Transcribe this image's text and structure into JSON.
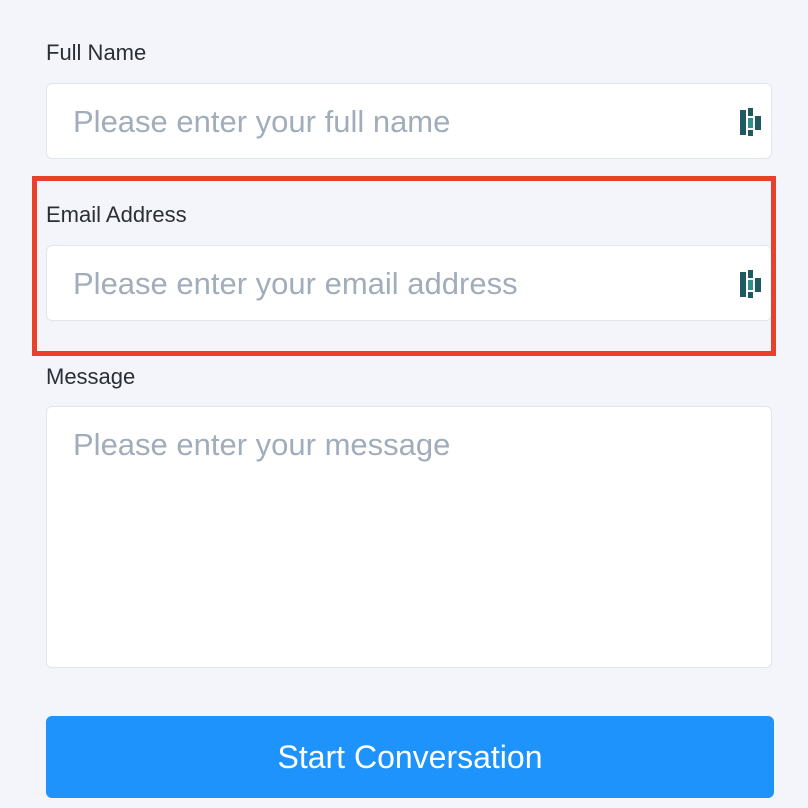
{
  "form": {
    "full_name": {
      "label": "Full Name",
      "value": "",
      "placeholder": "Please enter your full name"
    },
    "email": {
      "label": "Email Address",
      "value": "",
      "placeholder": "Please enter your email address"
    },
    "message": {
      "label": "Message",
      "value": "",
      "placeholder": "Please enter your message"
    },
    "submit_label": "Start Conversation"
  },
  "icons": {
    "field_autofill": "password-manager-icon"
  },
  "colors": {
    "page_background": "#f4f5fa",
    "button": "#1e93fc",
    "highlight": "#e8402a",
    "icon": "#1f5a62",
    "placeholder": "#a2adbb"
  }
}
